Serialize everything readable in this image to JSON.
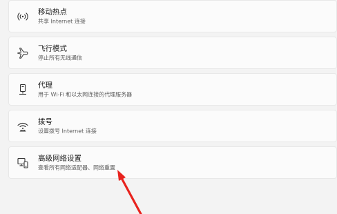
{
  "items": [
    {
      "icon": "hotspot-icon",
      "title": "移动热点",
      "description": "共享 Internet 连接"
    },
    {
      "icon": "airplane-icon",
      "title": "飞行模式",
      "description": "停止所有无线通信"
    },
    {
      "icon": "proxy-icon",
      "title": "代理",
      "description": "用于 Wi-Fi 和以太网连接的代理服务器"
    },
    {
      "icon": "dialup-icon",
      "title": "拨号",
      "description": "设置拨号 Internet 连接"
    },
    {
      "icon": "advanced-network-icon",
      "title": "高级网络设置",
      "description": "查看所有网络适配器、网络重置"
    }
  ],
  "annotation": {
    "type": "red-arrow",
    "color": "#e8231e"
  }
}
